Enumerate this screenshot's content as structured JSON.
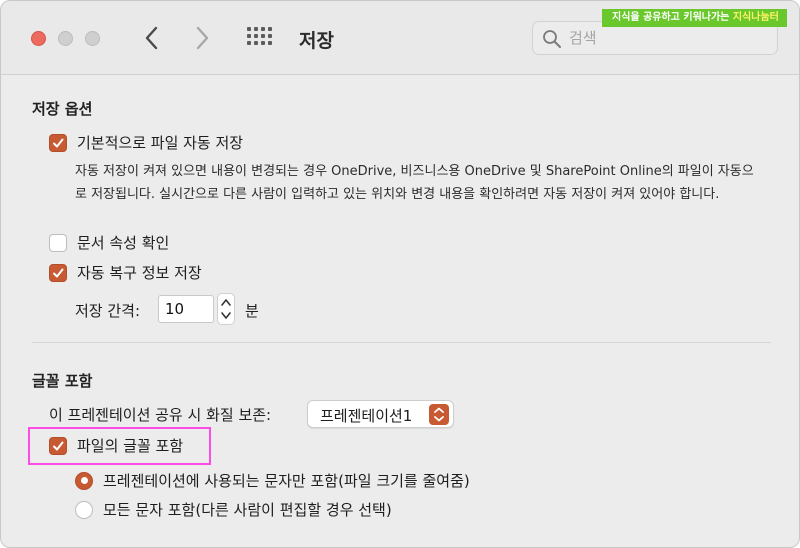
{
  "toolbar": {
    "title": "저장",
    "search_placeholder": "검색"
  },
  "watermark": {
    "text": "지식을 공유하고 키워나가는 ",
    "brand": "지식나눔터"
  },
  "save_options": {
    "heading": "저장 옵션",
    "autosave_label": "기본적으로 파일 자동 저장",
    "autosave_checked": true,
    "autosave_description": "자동 저장이 켜져 있으면 내용이 변경되는 경우 OneDrive, 비즈니스용 OneDrive 및 SharePoint Online의 파일이 자동으로 저장됩니다. 실시간으로 다른 사람이 입력하고 있는 위치와 변경 내용을 확인하려면 자동 저장이 켜져 있어야 합니다.",
    "doc_props_label": "문서 속성 확인",
    "doc_props_checked": false,
    "autorecover_label": "자동 복구 정보 저장",
    "autorecover_checked": true,
    "interval_label": "저장 간격:",
    "interval_value": "10",
    "interval_unit": "분"
  },
  "font_embed": {
    "heading": "글꼴 포함",
    "quality_label": "이 프레젠테이션 공유 시 화질 보존:",
    "quality_selected": "프레젠테이션1",
    "embed_label": "파일의 글꼴 포함",
    "embed_checked": true,
    "option_used_label": "프레젠테이션에 사용되는 문자만 포함(파일 크기를 줄여줌)",
    "option_used_selected": true,
    "option_all_label": "모든 문자 포함(다른 사람이 편집할 경우 선택)",
    "option_all_selected": false
  },
  "colors": {
    "accent": "#c85a33",
    "highlight_box": "#ff4be6",
    "watermark_bg": "#6ac82c"
  }
}
